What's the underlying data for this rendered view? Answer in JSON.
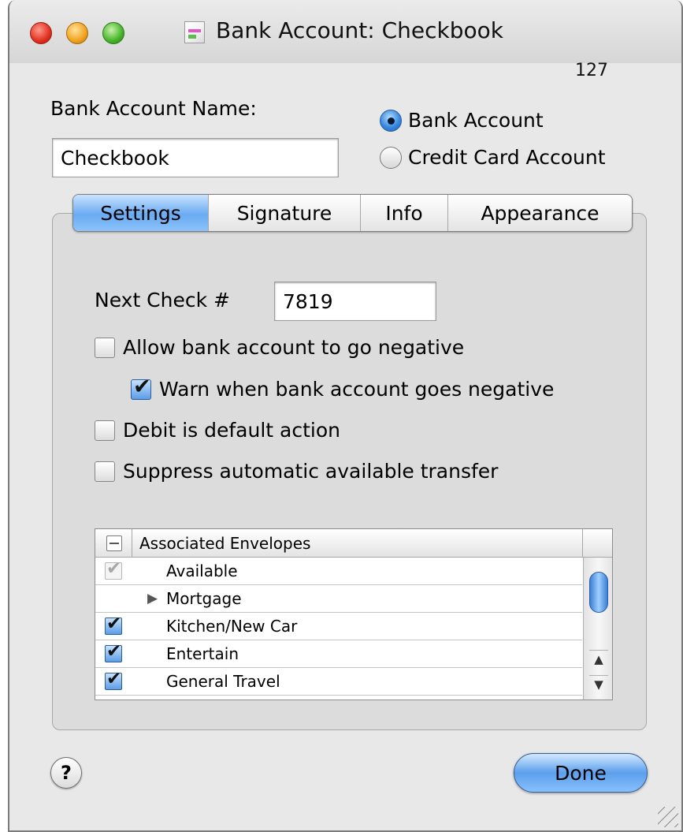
{
  "window": {
    "title": "Bank Account: Checkbook",
    "count": "127"
  },
  "account": {
    "name_label": "Bank Account Name:",
    "name_value": "Checkbook",
    "type_options": [
      {
        "label": "Bank Account",
        "selected": true
      },
      {
        "label": "Credit Card Account",
        "selected": false
      }
    ]
  },
  "tabs": [
    {
      "label": "Settings",
      "active": true
    },
    {
      "label": "Signature",
      "active": false
    },
    {
      "label": "Info",
      "active": false
    },
    {
      "label": "Appearance",
      "active": false
    }
  ],
  "settings": {
    "next_check_label": "Next Check #",
    "next_check_value": "7819",
    "options": [
      {
        "label": "Allow bank account to go negative",
        "checked": false
      },
      {
        "label": "Warn when bank account goes negative",
        "checked": true
      },
      {
        "label": "Debit is default action",
        "checked": false
      },
      {
        "label": "Suppress automatic available transfer",
        "checked": false
      }
    ]
  },
  "envelopes": {
    "header": "Associated Envelopes",
    "rows": [
      {
        "label": "Available",
        "state": "dim"
      },
      {
        "label": "Mortgage",
        "state": "none",
        "group": true
      },
      {
        "label": "Kitchen/New Car",
        "state": "checked"
      },
      {
        "label": "Entertain",
        "state": "checked"
      },
      {
        "label": "General Travel",
        "state": "checked"
      }
    ]
  },
  "footer": {
    "help_label": "?",
    "done_label": "Done"
  },
  "colors": {
    "accent": "#5c9fec",
    "window_bg": "#e8e8e8"
  }
}
